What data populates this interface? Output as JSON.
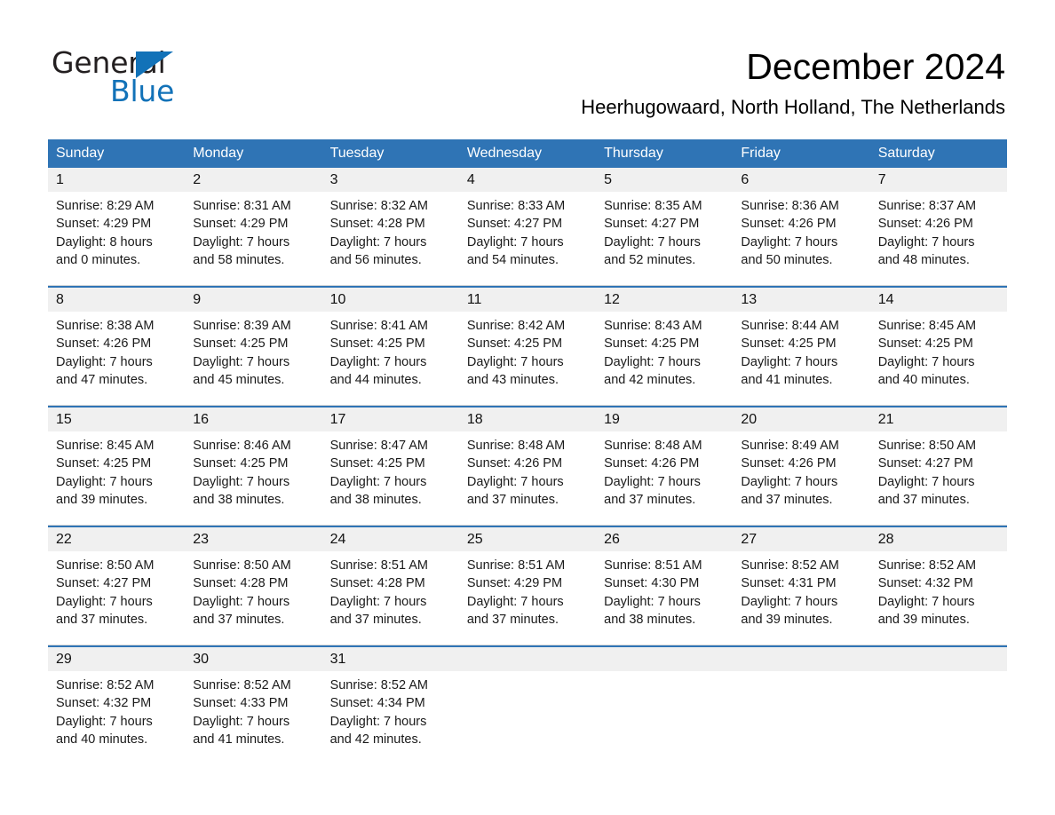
{
  "brand": {
    "name_part1": "General",
    "name_part2": "Blue",
    "accent_color": "#1272b8"
  },
  "header": {
    "title": "December 2024",
    "location": "Heerhugowaard, North Holland, The Netherlands"
  },
  "theme": {
    "header_blue": "#2f74b5",
    "daynum_band": "#f0f0f0",
    "row_divider": "#d9d9d9"
  },
  "weekdays": [
    "Sunday",
    "Monday",
    "Tuesday",
    "Wednesday",
    "Thursday",
    "Friday",
    "Saturday"
  ],
  "weeks": [
    [
      {
        "day": "1",
        "sunrise": "Sunrise: 8:29 AM",
        "sunset": "Sunset: 4:29 PM",
        "daylight1": "Daylight: 8 hours",
        "daylight2": "and 0 minutes."
      },
      {
        "day": "2",
        "sunrise": "Sunrise: 8:31 AM",
        "sunset": "Sunset: 4:29 PM",
        "daylight1": "Daylight: 7 hours",
        "daylight2": "and 58 minutes."
      },
      {
        "day": "3",
        "sunrise": "Sunrise: 8:32 AM",
        "sunset": "Sunset: 4:28 PM",
        "daylight1": "Daylight: 7 hours",
        "daylight2": "and 56 minutes."
      },
      {
        "day": "4",
        "sunrise": "Sunrise: 8:33 AM",
        "sunset": "Sunset: 4:27 PM",
        "daylight1": "Daylight: 7 hours",
        "daylight2": "and 54 minutes."
      },
      {
        "day": "5",
        "sunrise": "Sunrise: 8:35 AM",
        "sunset": "Sunset: 4:27 PM",
        "daylight1": "Daylight: 7 hours",
        "daylight2": "and 52 minutes."
      },
      {
        "day": "6",
        "sunrise": "Sunrise: 8:36 AM",
        "sunset": "Sunset: 4:26 PM",
        "daylight1": "Daylight: 7 hours",
        "daylight2": "and 50 minutes."
      },
      {
        "day": "7",
        "sunrise": "Sunrise: 8:37 AM",
        "sunset": "Sunset: 4:26 PM",
        "daylight1": "Daylight: 7 hours",
        "daylight2": "and 48 minutes."
      }
    ],
    [
      {
        "day": "8",
        "sunrise": "Sunrise: 8:38 AM",
        "sunset": "Sunset: 4:26 PM",
        "daylight1": "Daylight: 7 hours",
        "daylight2": "and 47 minutes."
      },
      {
        "day": "9",
        "sunrise": "Sunrise: 8:39 AM",
        "sunset": "Sunset: 4:25 PM",
        "daylight1": "Daylight: 7 hours",
        "daylight2": "and 45 minutes."
      },
      {
        "day": "10",
        "sunrise": "Sunrise: 8:41 AM",
        "sunset": "Sunset: 4:25 PM",
        "daylight1": "Daylight: 7 hours",
        "daylight2": "and 44 minutes."
      },
      {
        "day": "11",
        "sunrise": "Sunrise: 8:42 AM",
        "sunset": "Sunset: 4:25 PM",
        "daylight1": "Daylight: 7 hours",
        "daylight2": "and 43 minutes."
      },
      {
        "day": "12",
        "sunrise": "Sunrise: 8:43 AM",
        "sunset": "Sunset: 4:25 PM",
        "daylight1": "Daylight: 7 hours",
        "daylight2": "and 42 minutes."
      },
      {
        "day": "13",
        "sunrise": "Sunrise: 8:44 AM",
        "sunset": "Sunset: 4:25 PM",
        "daylight1": "Daylight: 7 hours",
        "daylight2": "and 41 minutes."
      },
      {
        "day": "14",
        "sunrise": "Sunrise: 8:45 AM",
        "sunset": "Sunset: 4:25 PM",
        "daylight1": "Daylight: 7 hours",
        "daylight2": "and 40 minutes."
      }
    ],
    [
      {
        "day": "15",
        "sunrise": "Sunrise: 8:45 AM",
        "sunset": "Sunset: 4:25 PM",
        "daylight1": "Daylight: 7 hours",
        "daylight2": "and 39 minutes."
      },
      {
        "day": "16",
        "sunrise": "Sunrise: 8:46 AM",
        "sunset": "Sunset: 4:25 PM",
        "daylight1": "Daylight: 7 hours",
        "daylight2": "and 38 minutes."
      },
      {
        "day": "17",
        "sunrise": "Sunrise: 8:47 AM",
        "sunset": "Sunset: 4:25 PM",
        "daylight1": "Daylight: 7 hours",
        "daylight2": "and 38 minutes."
      },
      {
        "day": "18",
        "sunrise": "Sunrise: 8:48 AM",
        "sunset": "Sunset: 4:26 PM",
        "daylight1": "Daylight: 7 hours",
        "daylight2": "and 37 minutes."
      },
      {
        "day": "19",
        "sunrise": "Sunrise: 8:48 AM",
        "sunset": "Sunset: 4:26 PM",
        "daylight1": "Daylight: 7 hours",
        "daylight2": "and 37 minutes."
      },
      {
        "day": "20",
        "sunrise": "Sunrise: 8:49 AM",
        "sunset": "Sunset: 4:26 PM",
        "daylight1": "Daylight: 7 hours",
        "daylight2": "and 37 minutes."
      },
      {
        "day": "21",
        "sunrise": "Sunrise: 8:50 AM",
        "sunset": "Sunset: 4:27 PM",
        "daylight1": "Daylight: 7 hours",
        "daylight2": "and 37 minutes."
      }
    ],
    [
      {
        "day": "22",
        "sunrise": "Sunrise: 8:50 AM",
        "sunset": "Sunset: 4:27 PM",
        "daylight1": "Daylight: 7 hours",
        "daylight2": "and 37 minutes."
      },
      {
        "day": "23",
        "sunrise": "Sunrise: 8:50 AM",
        "sunset": "Sunset: 4:28 PM",
        "daylight1": "Daylight: 7 hours",
        "daylight2": "and 37 minutes."
      },
      {
        "day": "24",
        "sunrise": "Sunrise: 8:51 AM",
        "sunset": "Sunset: 4:28 PM",
        "daylight1": "Daylight: 7 hours",
        "daylight2": "and 37 minutes."
      },
      {
        "day": "25",
        "sunrise": "Sunrise: 8:51 AM",
        "sunset": "Sunset: 4:29 PM",
        "daylight1": "Daylight: 7 hours",
        "daylight2": "and 37 minutes."
      },
      {
        "day": "26",
        "sunrise": "Sunrise: 8:51 AM",
        "sunset": "Sunset: 4:30 PM",
        "daylight1": "Daylight: 7 hours",
        "daylight2": "and 38 minutes."
      },
      {
        "day": "27",
        "sunrise": "Sunrise: 8:52 AM",
        "sunset": "Sunset: 4:31 PM",
        "daylight1": "Daylight: 7 hours",
        "daylight2": "and 39 minutes."
      },
      {
        "day": "28",
        "sunrise": "Sunrise: 8:52 AM",
        "sunset": "Sunset: 4:32 PM",
        "daylight1": "Daylight: 7 hours",
        "daylight2": "and 39 minutes."
      }
    ],
    [
      {
        "day": "29",
        "sunrise": "Sunrise: 8:52 AM",
        "sunset": "Sunset: 4:32 PM",
        "daylight1": "Daylight: 7 hours",
        "daylight2": "and 40 minutes."
      },
      {
        "day": "30",
        "sunrise": "Sunrise: 8:52 AM",
        "sunset": "Sunset: 4:33 PM",
        "daylight1": "Daylight: 7 hours",
        "daylight2": "and 41 minutes."
      },
      {
        "day": "31",
        "sunrise": "Sunrise: 8:52 AM",
        "sunset": "Sunset: 4:34 PM",
        "daylight1": "Daylight: 7 hours",
        "daylight2": "and 42 minutes."
      },
      {
        "day": "",
        "sunrise": "",
        "sunset": "",
        "daylight1": "",
        "daylight2": "",
        "empty": true
      },
      {
        "day": "",
        "sunrise": "",
        "sunset": "",
        "daylight1": "",
        "daylight2": "",
        "empty": true
      },
      {
        "day": "",
        "sunrise": "",
        "sunset": "",
        "daylight1": "",
        "daylight2": "",
        "empty": true
      },
      {
        "day": "",
        "sunrise": "",
        "sunset": "",
        "daylight1": "",
        "daylight2": "",
        "empty": true
      }
    ]
  ]
}
